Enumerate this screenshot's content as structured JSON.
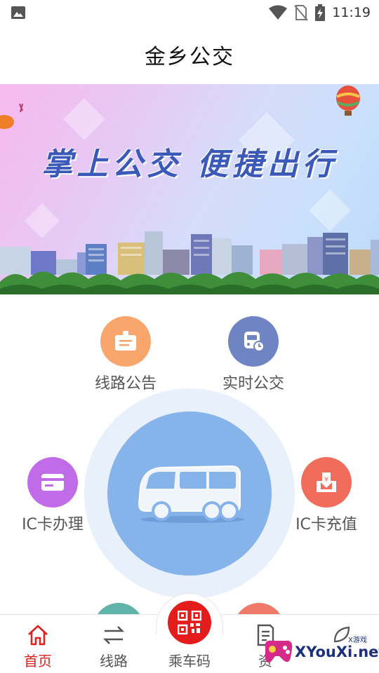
{
  "status_bar": {
    "time": "11:19",
    "icons": [
      "image-icon",
      "wifi-icon",
      "no-sim-icon",
      "battery-charging-icon"
    ]
  },
  "header": {
    "title": "金乡公交"
  },
  "banner": {
    "slogan": "掌上公交  便捷出行"
  },
  "menu": {
    "route_notice": {
      "label": "线路公告",
      "color": "#f9a66c",
      "icon": "notice-board-icon"
    },
    "realtime_bus": {
      "label": "实时公交",
      "color": "#6f84c3",
      "icon": "bus-clock-icon"
    },
    "ic_card_apply": {
      "label": "IC卡办理",
      "color": "#c06be8",
      "icon": "card-icon"
    },
    "ic_card_recharge": {
      "label": "IC卡充值",
      "color": "#f26c5c",
      "icon": "recharge-icon"
    },
    "center": {
      "icon": "bus-icon",
      "color": "#86b4ea"
    }
  },
  "tab_bar": {
    "active_color": "#e02020",
    "tabs": [
      {
        "label": "首页",
        "icon": "home-icon"
      },
      {
        "label": "线路",
        "icon": "swap-arrows-icon"
      },
      {
        "label": "乘车码",
        "icon": "qr-code-icon"
      },
      {
        "label": "资",
        "icon": "document-icon"
      },
      {
        "label": "",
        "icon": "leaf-icon"
      }
    ]
  },
  "watermark": {
    "text": "XYouXi.net",
    "small": "X游戏"
  }
}
